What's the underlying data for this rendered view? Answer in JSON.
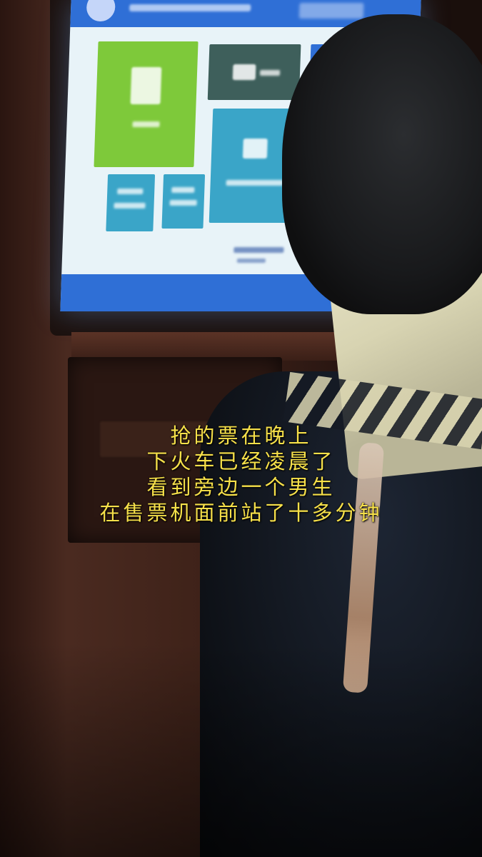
{
  "caption": {
    "lines": [
      "抢的票在晚上",
      "下火车已经凌晨了",
      "看到旁边一个男生",
      "在售票机面前站了十多分钟"
    ]
  },
  "colors": {
    "caption_text": "#f6e04a",
    "screen_header": "#2f6fd6",
    "tile_green": "#7ec93a",
    "tile_teal": "#3aa5c8",
    "tile_dark": "#3e5f5b"
  }
}
